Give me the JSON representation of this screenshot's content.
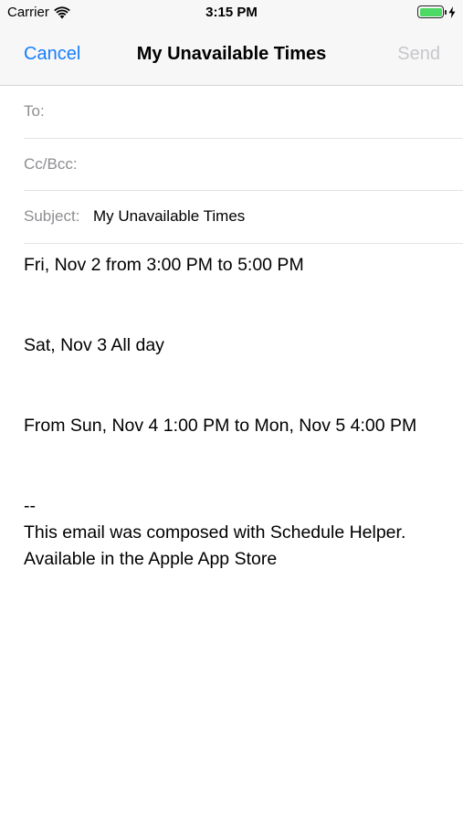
{
  "status_bar": {
    "carrier": "Carrier",
    "time": "3:15 PM",
    "battery_level": 1.0,
    "battery_color": "#4cd964"
  },
  "nav": {
    "cancel_label": "Cancel",
    "title": "My Unavailable Times",
    "send_label": "Send",
    "accent_color": "#157efb",
    "disabled_color": "#c7c7cc"
  },
  "fields": {
    "to_label": "To:",
    "to_value": "",
    "cc_label": "Cc/Bcc:",
    "cc_value": "",
    "subject_label": "Subject:",
    "subject_value": "My Unavailable Times"
  },
  "body": {
    "lines": [
      "Fri, Nov 2 from 3:00 PM to 5:00 PM",
      "",
      "Sat, Nov 3 All day",
      "",
      "From Sun, Nov 4 1:00 PM to Mon, Nov 5 4:00 PM",
      "",
      "--",
      "This email was composed with Schedule Helper.",
      "Available in the Apple App Store"
    ]
  }
}
